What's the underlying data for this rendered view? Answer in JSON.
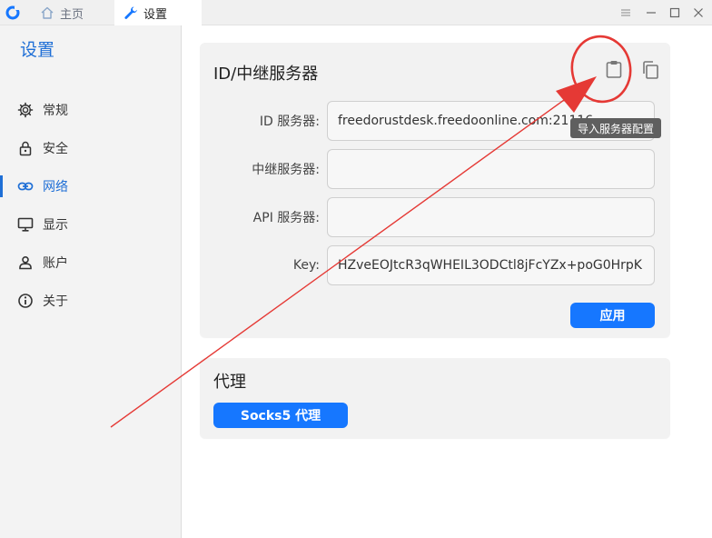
{
  "tabs": {
    "home_label": "主页",
    "settings_label": "设置"
  },
  "sidebar": {
    "title": "设置",
    "items": [
      {
        "label": "常规",
        "icon": "gear-icon"
      },
      {
        "label": "安全",
        "icon": "lock-icon"
      },
      {
        "label": "网络",
        "icon": "link-icon",
        "active": true
      },
      {
        "label": "显示",
        "icon": "monitor-icon"
      },
      {
        "label": "账户",
        "icon": "person-icon"
      },
      {
        "label": "关于",
        "icon": "info-icon"
      }
    ]
  },
  "server_card": {
    "title": "ID/中继服务器",
    "tooltip": "导入服务器配置",
    "fields": {
      "id_label": "ID 服务器:",
      "id_value": "freedorustdesk.freedoonline.com:21116",
      "relay_label": "中继服务器:",
      "relay_value": "",
      "api_label": "API 服务器:",
      "api_value": "",
      "key_label": "Key:",
      "key_value": "HZveEOJtcR3qWHEIL3ODCtl8jFcYZx+poG0HrpK"
    },
    "apply_label": "应用"
  },
  "proxy_card": {
    "title": "代理",
    "socks_label": "Socks5 代理"
  },
  "colors": {
    "accent": "#1f6fd6",
    "button": "#1677ff",
    "annotation": "#e53935"
  }
}
